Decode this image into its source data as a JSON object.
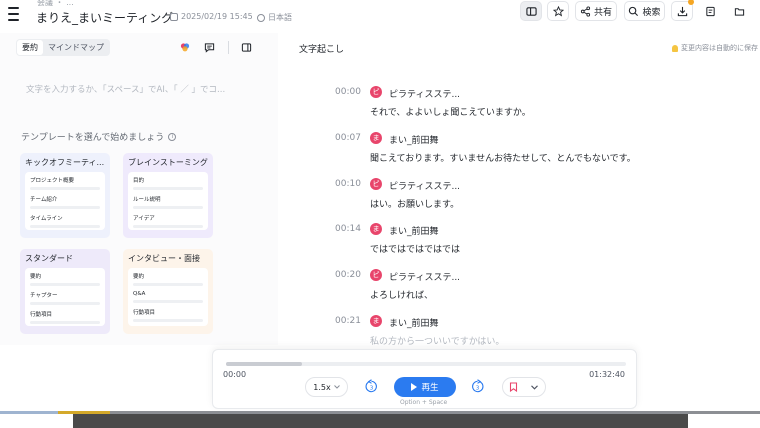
{
  "header": {
    "breadcrumb": "会議 ・ ...",
    "title": "まりえ_まいミーティング",
    "date": "2025/02/19 15:45",
    "language": "日本語",
    "share_label": "共有",
    "search_label": "検索"
  },
  "left": {
    "tabs": [
      {
        "label": "要約",
        "active": true
      },
      {
        "label": "マインドマップ",
        "active": false
      }
    ],
    "prompt_placeholder": "文字を入力するか、「スペース」でAI、「 ／ 」でコ...",
    "templates_heading": "テンプレートを選んで始めましょう",
    "templates": [
      {
        "title": "キックオフミーティ...",
        "color": "#eef1fc",
        "lines": [
          "プロジェクト概要",
          "チーム紹介",
          "タイムライン"
        ]
      },
      {
        "title": "ブレインストーミング",
        "color": "#efeafc",
        "lines": [
          "目的",
          "ルール説明",
          "アイデア"
        ]
      },
      {
        "title": "スタンダード",
        "color": "#eeeafa",
        "lines": [
          "要約",
          "チャプター",
          "行動項目"
        ]
      },
      {
        "title": "インタビュー・面接",
        "color": "#fdf4ea",
        "lines": [
          "要約",
          "Q&A",
          "行動項目"
        ]
      }
    ]
  },
  "transcript": {
    "title": "文字起こし",
    "autosave_note": "変更内容は自動的に保存",
    "segments": [
      {
        "time": "00:00",
        "avatar": "ピ",
        "speaker": "ピラティスステ...",
        "text": "それで、よよいしょ聞こえていますか。"
      },
      {
        "time": "00:07",
        "avatar": "ま",
        "speaker": "まい_前田舞",
        "text": "聞こえております。すいませんお待たせして、とんでもないです。"
      },
      {
        "time": "00:10",
        "avatar": "ピ",
        "speaker": "ピラティスステ...",
        "text": "はい。お願いします。"
      },
      {
        "time": "00:14",
        "avatar": "ま",
        "speaker": "まい_前田舞",
        "text": "ではではではではでは"
      },
      {
        "time": "00:20",
        "avatar": "ピ",
        "speaker": "ピラティスステ...",
        "text": "よろしければ、"
      },
      {
        "time": "00:21",
        "avatar": "ま",
        "speaker": "まい_前田舞",
        "text": "私の方から一ついいですかはい。"
      }
    ]
  },
  "player": {
    "current_time": "00:00",
    "total_time": "01:32:40",
    "progress_fraction": 0.19,
    "speed": "1.5x",
    "skip_seconds": "3",
    "play_label": "再生",
    "shortcut_hint": "Option + Space"
  },
  "colors": {
    "accent": "#2b7bf0",
    "avatar": "#e8456b"
  }
}
